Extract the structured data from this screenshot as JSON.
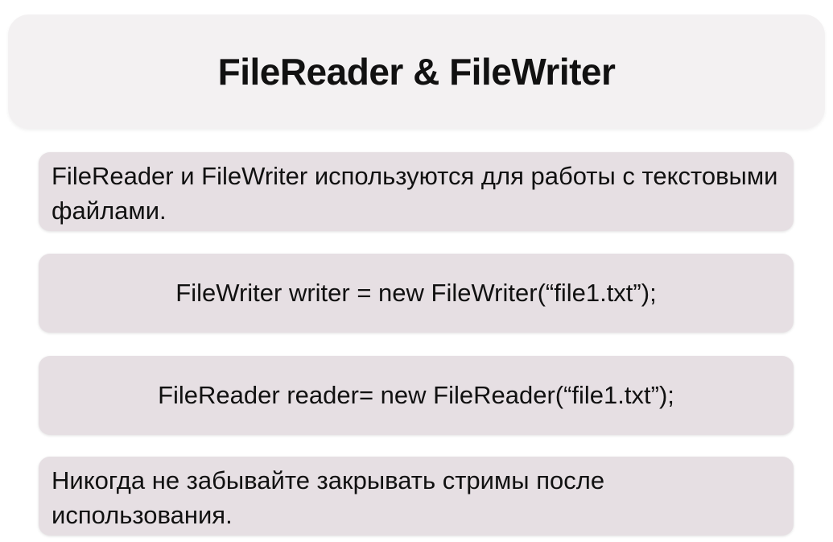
{
  "title": "FileReader & FileWriter",
  "items": [
    {
      "text": "FileReader и FileWriter используются для работы с текстовыми файлами."
    },
    {
      "text": "FileWriter writer = new FileWriter(“file1.txt”);"
    },
    {
      "text": "FileReader reader= new FileReader(“file1.txt”);"
    },
    {
      "text": "Никогда не забывайте закрывать стримы после использования."
    }
  ],
  "colors": {
    "title_background": "#f3f1f2",
    "box_background": "#e6dfe3",
    "text": "#111111"
  }
}
